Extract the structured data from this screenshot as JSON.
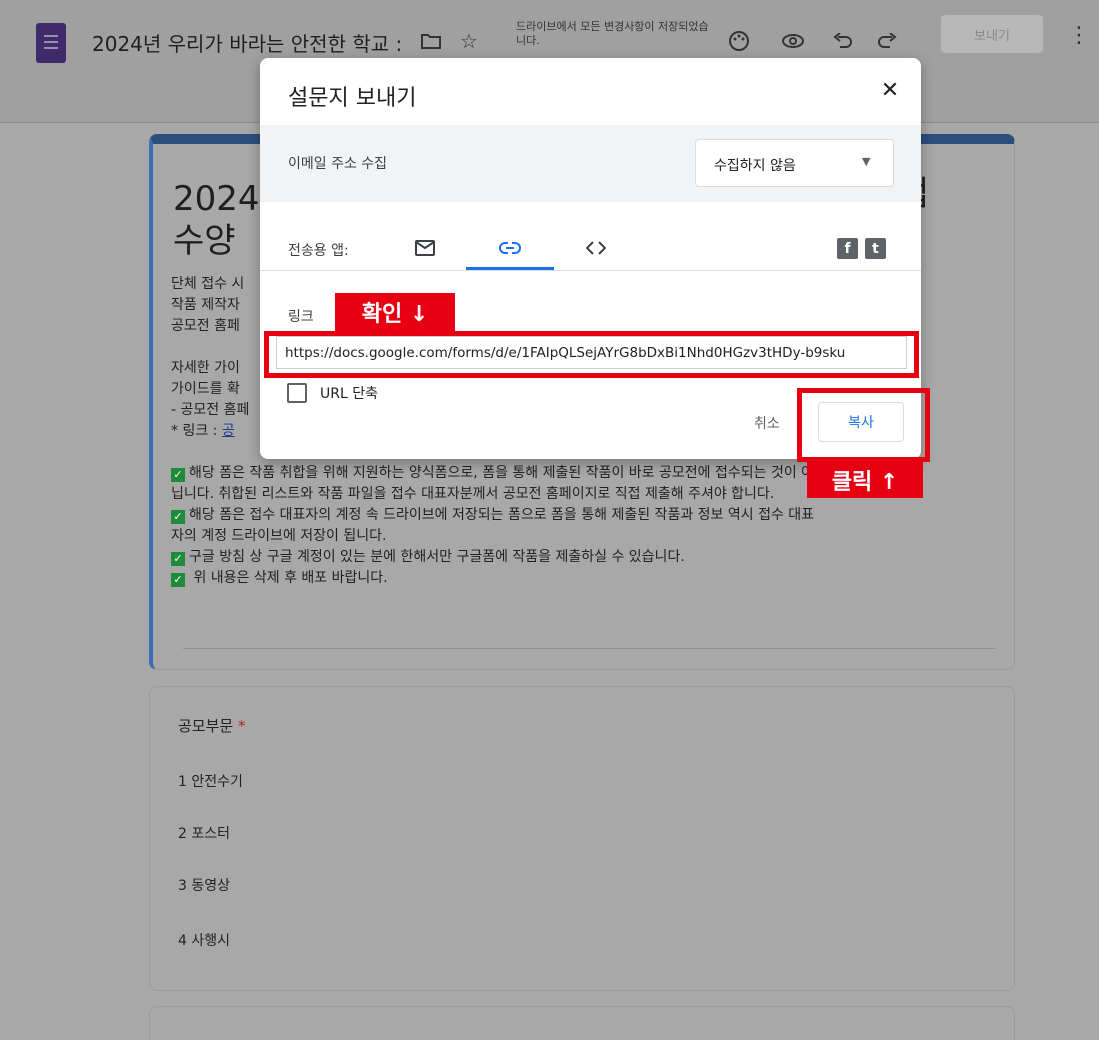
{
  "header": {
    "doc_title": "2024년 우리가 바라는 안전한 학교 :",
    "save_status": "드라이브에서 모든 변경사항이 저장되었습니다.",
    "send_button": "보내기",
    "icons": [
      "forms-logo-icon",
      "folder-icon",
      "star-icon",
      "palette-icon",
      "preview-eye-icon",
      "undo-icon",
      "redo-icon",
      "more-vert-icon"
    ]
  },
  "form": {
    "title_line1": "2024",
    "title_line2": "수양",
    "title_right": "접",
    "description": [
      "단체 접수 시",
      "작품 제작자",
      "공모전 홈페",
      "",
      "자세한 가이",
      "가이드를 확",
      "- 공모전 홈페",
      " * 링크 : "
    ],
    "link_text": "공",
    "notices": [
      "해당 폼은 작품 취합을 위해 지원하는 양식폼으로, 폼을 통해 제출된 작품이 바로 공모전에 접수되는 것이 아",
      "닙니다. 취합된 리스트와 작품 파일을 접수 대표자분께서 공모전 홈페이지로 직접 제출해 주셔야 합니다.",
      "해당 폼은 접수 대표자의 계정 속 드라이브에 저장되는 폼으로 폼을 통해 제출된 작품과 정보 역시 접수 대표",
      "자의 계정 드라이브에 저장이 됩니다.",
      "구글 방침 상 구글 계정이 있는 분에 한해서만 구글폼에 작품을 제출하실 수 있습니다.",
      " 위 내용은 삭제 후 배포 바랍니다."
    ]
  },
  "question": {
    "title": "공모부문",
    "required_mark": "*",
    "options": [
      "1  안전수기",
      "2  포스터",
      "3  동영상",
      "4  사행시"
    ]
  },
  "dialog": {
    "title": "설문지 보내기",
    "close_icon": "✕",
    "email_label": "이메일 주소 수집",
    "email_value": "수집하지 않음",
    "send_via_label": "전송용 앱:",
    "tabs": [
      "email-icon",
      "link-icon",
      "embed-icon"
    ],
    "link_label": "링크",
    "url": "https://docs.google.com/forms/d/e/1FAIpQLSejAYrG8bDxBi1Nhd0HGzv3tHDy-b9sku",
    "shorten_label": "URL 단축",
    "cancel_label": "취소",
    "copy_label": "복사",
    "facebook_glyph": "f",
    "twitter_glyph": "t"
  },
  "annotations": {
    "confirm_label": "확인 ↓",
    "click_label": "클릭 ↑",
    "color": "#e60012"
  }
}
